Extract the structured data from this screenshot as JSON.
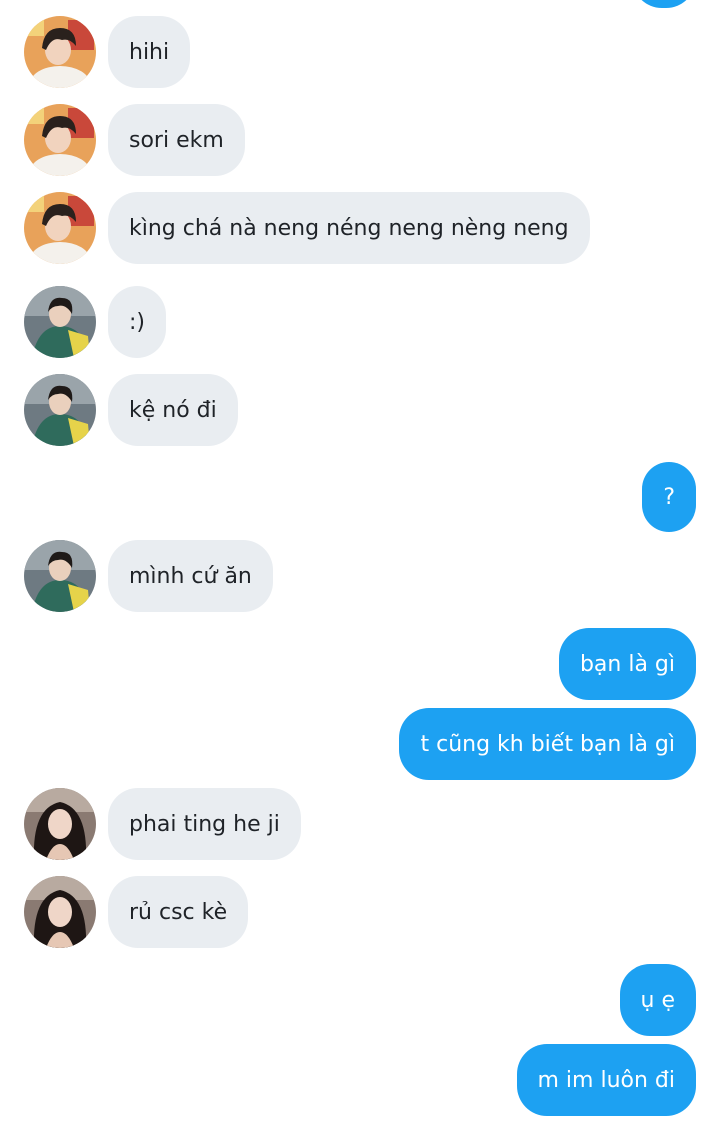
{
  "colors": {
    "incoming_bubble": "#e9edf1",
    "outgoing_bubble": "#1da1f2",
    "incoming_text": "#1f2328",
    "outgoing_text": "#ffffff"
  },
  "messages": [
    {
      "id": 1,
      "direction": "in",
      "sender_avatar": "avatar-boy-sweater",
      "text": "hihi"
    },
    {
      "id": 2,
      "direction": "in",
      "sender_avatar": "avatar-boy-sweater",
      "text": "sori ekm"
    },
    {
      "id": 3,
      "direction": "in",
      "sender_avatar": "avatar-boy-sweater",
      "text": "kìng chá nà neng néng neng nèng neng"
    },
    {
      "id": 4,
      "direction": "in",
      "sender_avatar": "avatar-boy-jacket",
      "text": ":)"
    },
    {
      "id": 5,
      "direction": "in",
      "sender_avatar": "avatar-boy-jacket",
      "text": "kệ nó đi"
    },
    {
      "id": 6,
      "direction": "out",
      "text": "?"
    },
    {
      "id": 7,
      "direction": "in",
      "sender_avatar": "avatar-boy-jacket",
      "text": "mình cứ ăn"
    },
    {
      "id": 8,
      "direction": "out",
      "text": "bạn là gì"
    },
    {
      "id": 9,
      "direction": "out",
      "text": "t cũng kh biết bạn là gì"
    },
    {
      "id": 10,
      "direction": "in",
      "sender_avatar": "avatar-girl",
      "text": "phai ting he ji"
    },
    {
      "id": 11,
      "direction": "in",
      "sender_avatar": "avatar-girl",
      "text": "rủ csc kè"
    },
    {
      "id": 12,
      "direction": "out",
      "text": "ụ ẹ"
    },
    {
      "id": 13,
      "direction": "out",
      "text": "m im luôn đi"
    }
  ]
}
